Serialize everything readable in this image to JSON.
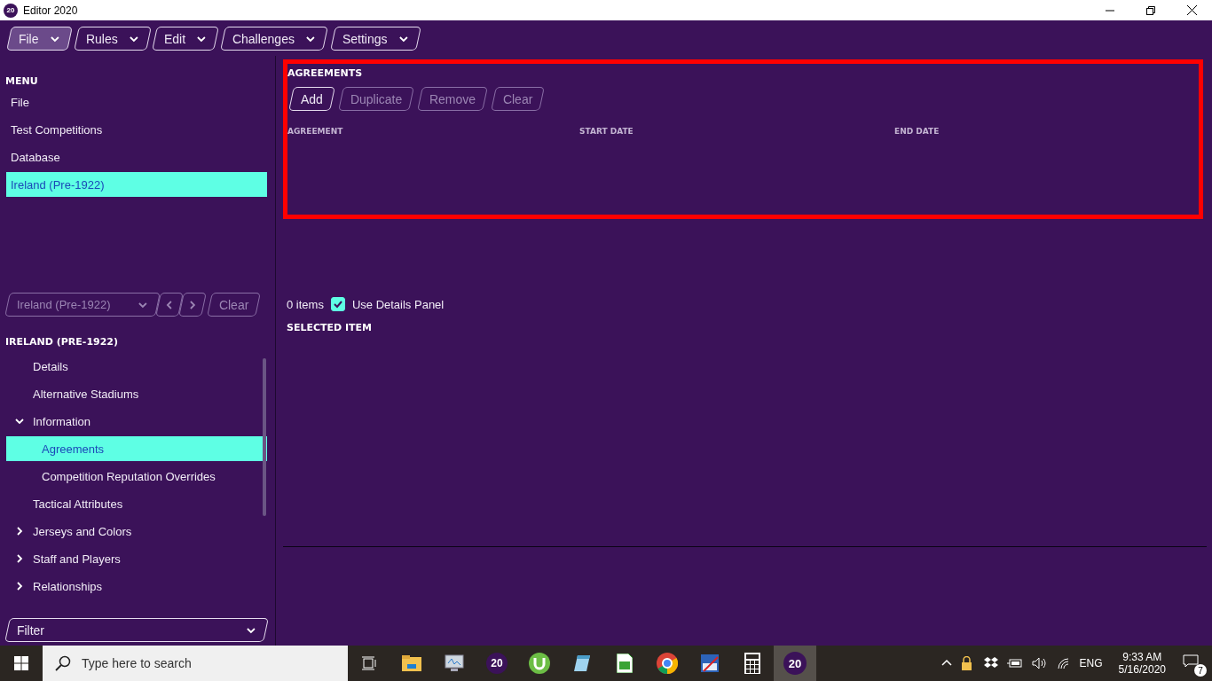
{
  "window": {
    "title": "Editor 2020",
    "logo": "20"
  },
  "toolbar": [
    {
      "label": "File",
      "selected": true
    },
    {
      "label": "Rules",
      "selected": false
    },
    {
      "label": "Edit",
      "selected": false
    },
    {
      "label": "Challenges",
      "selected": false
    },
    {
      "label": "Settings",
      "selected": false
    }
  ],
  "menu": {
    "heading": "MENU",
    "items": [
      {
        "label": "File",
        "selected": false
      },
      {
        "label": "Test Competitions",
        "selected": false
      },
      {
        "label": "Database",
        "selected": false
      },
      {
        "label": "Ireland (Pre-1922)",
        "selected": true
      }
    ]
  },
  "navigator": {
    "value": "Ireland (Pre-1922)",
    "clear": "Clear"
  },
  "tree": {
    "heading": "IRELAND (PRE-1922)",
    "items": [
      {
        "label": "Details",
        "selected": false
      },
      {
        "label": "Alternative Stadiums",
        "selected": false
      },
      {
        "label": "Information",
        "selected": false,
        "expanded": true,
        "children": [
          {
            "label": "Agreements",
            "selected": true
          },
          {
            "label": "Competition Reputation Overrides",
            "selected": false
          }
        ]
      },
      {
        "label": "Tactical Attributes",
        "selected": false
      },
      {
        "label": "Jerseys and Colors",
        "selected": false,
        "expanded": false
      },
      {
        "label": "Staff and Players",
        "selected": false,
        "expanded": false
      },
      {
        "label": "Relationships",
        "selected": false,
        "expanded": false
      }
    ]
  },
  "filter": {
    "label": "Filter"
  },
  "agreements": {
    "title": "AGREEMENTS",
    "buttons": [
      {
        "label": "Add",
        "disabled": false
      },
      {
        "label": "Duplicate",
        "disabled": true
      },
      {
        "label": "Remove",
        "disabled": true
      },
      {
        "label": "Clear",
        "disabled": true
      }
    ],
    "columns": [
      "AGREEMENT",
      "START DATE",
      "END DATE"
    ]
  },
  "footer": {
    "count": "0 items",
    "use_details": {
      "label": "Use Details Panel",
      "checked": true
    },
    "selected_heading": "SELECTED ITEM"
  },
  "taskbar": {
    "search_placeholder": "Type here to search",
    "app_labels": [
      "20",
      "20"
    ],
    "time": "9:33 AM",
    "date": "5/16/2020",
    "language": "ENG",
    "notifications": "7"
  }
}
